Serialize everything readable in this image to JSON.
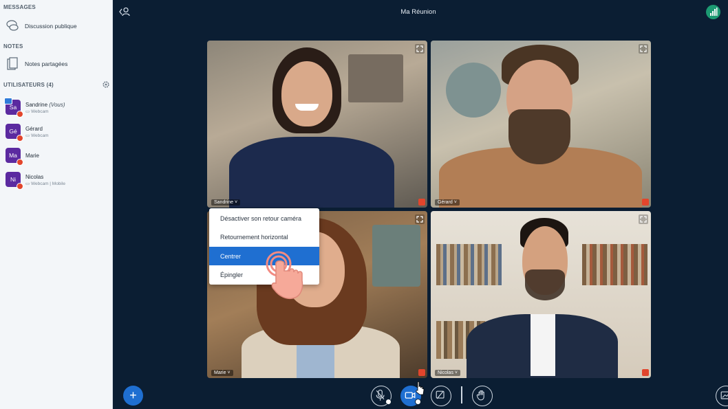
{
  "sidebar": {
    "messages_title": "MESSAGES",
    "public_chat": "Discussion publique",
    "notes_title": "NOTES",
    "shared_notes": "Notes partagées",
    "users_title": "UTILISATEURS (4)",
    "users": [
      {
        "initials": "Sa",
        "name": "Sandrine",
        "you": "(Vous)",
        "sub": "Webcam"
      },
      {
        "initials": "Gé",
        "name": "Gérard",
        "you": "",
        "sub": "Webcam"
      },
      {
        "initials": "Ma",
        "name": "Marie",
        "you": "",
        "sub": ""
      },
      {
        "initials": "Ni",
        "name": "Nicolas",
        "you": "",
        "sub": "Webcam | Mobile"
      }
    ]
  },
  "header": {
    "title": "Ma Réunion"
  },
  "tiles": [
    {
      "name": "Sandrine"
    },
    {
      "name": "Gérard"
    },
    {
      "name": "Marie"
    },
    {
      "name": "Nicolas"
    }
  ],
  "menu": {
    "items": [
      {
        "label": "Désactiver son retour caméra"
      },
      {
        "label": "Retournement horizontal"
      },
      {
        "label": "Centrer"
      },
      {
        "label": "Épingler"
      }
    ]
  },
  "bottom": {
    "plus": "+"
  },
  "colors": {
    "accent": "#1f6fd1",
    "background": "#0b1e33",
    "avatar": "#5b2aa0",
    "muted": "#e2452c",
    "connection": "#1c9a72"
  }
}
